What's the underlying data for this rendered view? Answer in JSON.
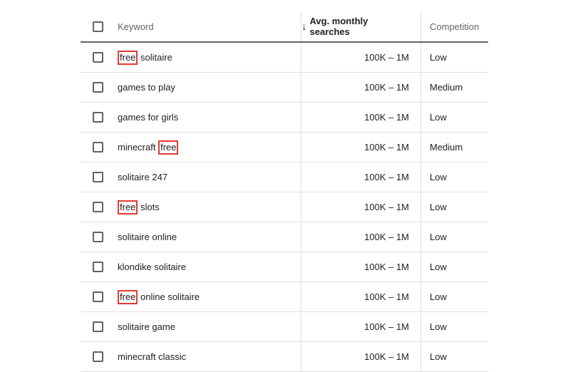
{
  "columns": {
    "keyword": "Keyword",
    "searches": "Avg. monthly searches",
    "competition": "Competition"
  },
  "sort": {
    "column": "searches",
    "direction_icon": "↓"
  },
  "highlight_term": "free",
  "rows": [
    {
      "keyword_parts": [
        {
          "t": "free",
          "hl": true
        },
        {
          "t": " solitaire"
        }
      ],
      "searches": "100K – 1M",
      "competition": "Low"
    },
    {
      "keyword_parts": [
        {
          "t": "games to play"
        }
      ],
      "searches": "100K – 1M",
      "competition": "Medium"
    },
    {
      "keyword_parts": [
        {
          "t": "games for girls"
        }
      ],
      "searches": "100K – 1M",
      "competition": "Low"
    },
    {
      "keyword_parts": [
        {
          "t": "minecraft "
        },
        {
          "t": "free",
          "hl": true
        }
      ],
      "searches": "100K – 1M",
      "competition": "Medium"
    },
    {
      "keyword_parts": [
        {
          "t": "solitaire 247"
        }
      ],
      "searches": "100K – 1M",
      "competition": "Low"
    },
    {
      "keyword_parts": [
        {
          "t": "free",
          "hl": true
        },
        {
          "t": " slots"
        }
      ],
      "searches": "100K – 1M",
      "competition": "Low"
    },
    {
      "keyword_parts": [
        {
          "t": "solitaire online"
        }
      ],
      "searches": "100K – 1M",
      "competition": "Low"
    },
    {
      "keyword_parts": [
        {
          "t": "klondike solitaire"
        }
      ],
      "searches": "100K – 1M",
      "competition": "Low"
    },
    {
      "keyword_parts": [
        {
          "t": "free",
          "hl": true
        },
        {
          "t": " online solitaire"
        }
      ],
      "searches": "100K – 1M",
      "competition": "Low"
    },
    {
      "keyword_parts": [
        {
          "t": "solitaire game"
        }
      ],
      "searches": "100K – 1M",
      "competition": "Low"
    },
    {
      "keyword_parts": [
        {
          "t": "minecraft classic"
        }
      ],
      "searches": "100K – 1M",
      "competition": "Low"
    }
  ]
}
